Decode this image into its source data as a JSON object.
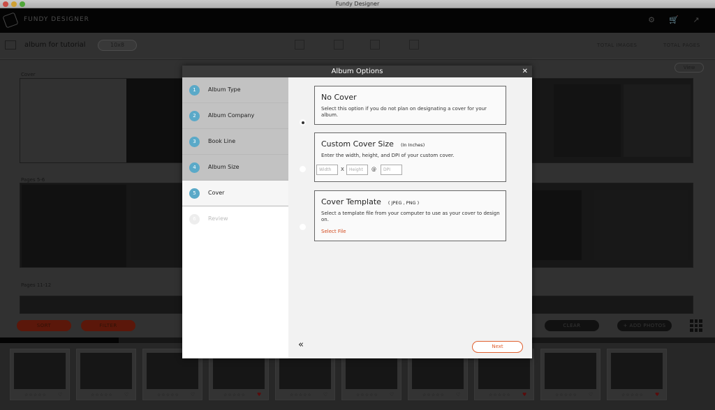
{
  "window": {
    "title": "Fundy Designer"
  },
  "app": {
    "brand": "FUNDY DESIGNER"
  },
  "toolbar": {
    "album_name": "album for tutorial",
    "size": "10x8",
    "total_images_label": "TOTAL IMAGES",
    "total_pages_label": "TOTAL PAGES"
  },
  "workarea": {
    "cover_label": "Cover",
    "pages_a_label": "Pages 5-6",
    "pages_b_label": "Pages 11-12",
    "view_label": "View"
  },
  "bottombar": {
    "sort_label": "SORT",
    "filter_label": "FILTER",
    "clear_label": "CLEAR",
    "add_photos_label": "+ ADD PHOTOS"
  },
  "dialog": {
    "title": "Album Options",
    "close_glyph": "✕",
    "steps": [
      {
        "num": "1",
        "label": "Album Type",
        "state": "done"
      },
      {
        "num": "2",
        "label": "Album Company",
        "state": "done"
      },
      {
        "num": "3",
        "label": "Book Line",
        "state": "done"
      },
      {
        "num": "4",
        "label": "Album Size",
        "state": "done"
      },
      {
        "num": "5",
        "label": "Cover",
        "state": "active"
      },
      {
        "num": "6",
        "label": "Review",
        "state": "pending"
      }
    ],
    "options": {
      "no_cover": {
        "title": "No Cover",
        "desc": "Select this option if you do not plan on designating a cover for your album.",
        "selected": true
      },
      "custom_size": {
        "title": "Custom Cover Size",
        "note": "(In Inches)",
        "desc": "Enter the width, height, and DPI of your custom cover.",
        "width_placeholder": "Width",
        "height_placeholder": "Height",
        "dpi_placeholder": "DPI",
        "x_sep": "X",
        "at_sep": "@",
        "selected": false
      },
      "template": {
        "title": "Cover Template",
        "note": "( JPEG , PNG )",
        "desc": "Select a template file from your computer to use as your cover to design on.",
        "select_file_label": "Select File",
        "selected": false
      }
    },
    "back_glyph": "«",
    "next_label": "Next"
  },
  "icons": {
    "back": "double-chevron-left-icon",
    "close": "close-icon"
  },
  "colors": {
    "accent": "#5aa9c8",
    "action": "#e0602f",
    "header": "#3a3a3a"
  }
}
